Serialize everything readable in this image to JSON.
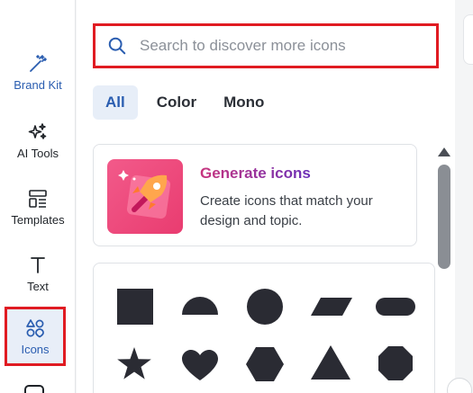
{
  "rail": {
    "items": [
      {
        "id": "brand-kit",
        "label": "Brand Kit",
        "icon": "magic-wand-icon"
      },
      {
        "id": "ai-tools",
        "label": "AI Tools",
        "icon": "sparkles-icon"
      },
      {
        "id": "templates",
        "label": "Templates",
        "icon": "templates-icon"
      },
      {
        "id": "text",
        "label": "Text",
        "icon": "text-icon"
      },
      {
        "id": "icons",
        "label": "Icons",
        "icon": "shapes-icon",
        "active": true
      }
    ]
  },
  "search": {
    "placeholder": "Search to discover more icons",
    "value": ""
  },
  "tabs": [
    {
      "label": "All",
      "active": true
    },
    {
      "label": "Color",
      "active": false
    },
    {
      "label": "Mono",
      "active": false
    }
  ],
  "generate_card": {
    "title": "Generate icons",
    "description": "Create icons that match your design and topic.",
    "icon": "rocket-icon"
  },
  "shapes": [
    "square",
    "half-circle",
    "circle",
    "parallelogram",
    "rounded-rectangle",
    "star",
    "heart",
    "hexagon",
    "triangle",
    "octagon"
  ],
  "colors": {
    "accent": "#2a5db0",
    "highlight_border": "#e01b22",
    "shape_fill": "#2a2b33",
    "active_tab_bg": "#e7eef8"
  }
}
